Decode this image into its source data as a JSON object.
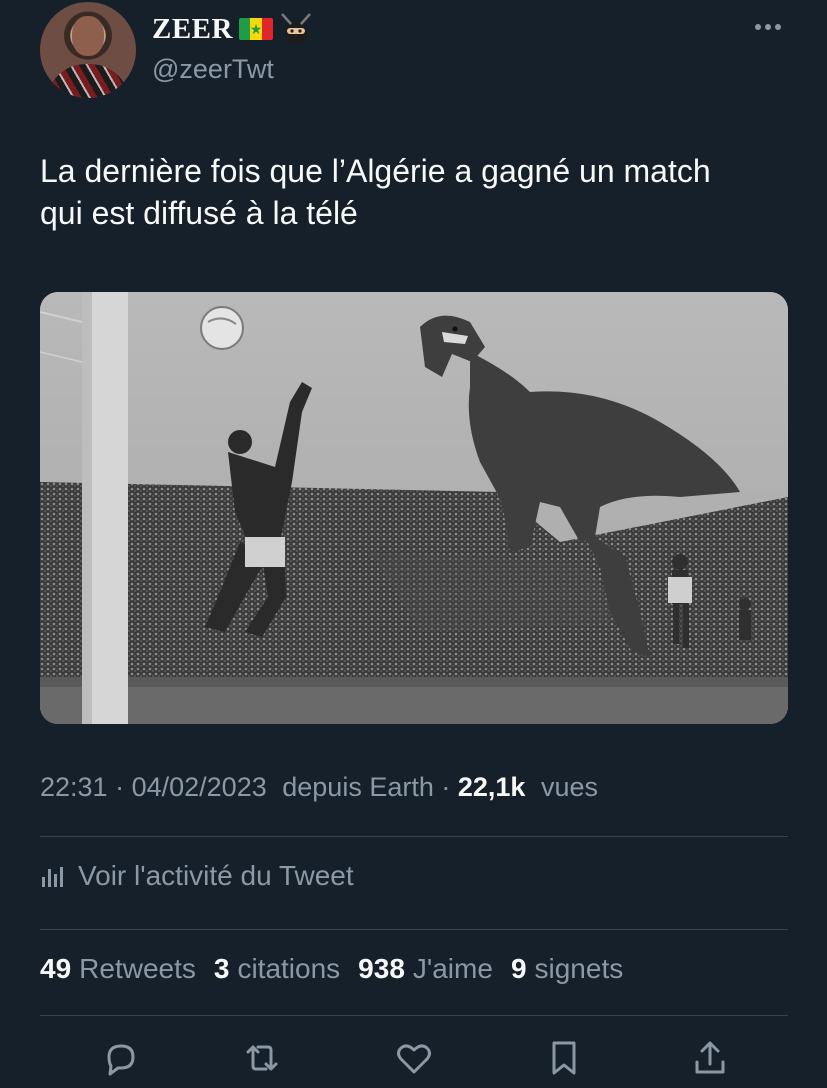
{
  "user": {
    "display_name": "ZEER",
    "handle": "@zeerTwt",
    "badges": [
      "senegal-flag-emoji",
      "ninja-emoji"
    ]
  },
  "tweet": {
    "text_line1": "La dernière fois que l’Algérie a gagné un match",
    "text_line2": "qui est diffusé à la télé",
    "time": "22:31",
    "date": "04/02/2023",
    "source": "depuis Earth",
    "views_count": "22,1k",
    "views_label": "vues"
  },
  "activity": {
    "label": "Voir l'activité du Tweet"
  },
  "stats": [
    {
      "count": "49",
      "label": "Retweets"
    },
    {
      "count": "3",
      "label": "citations"
    },
    {
      "count": "938",
      "label": "J'aime"
    },
    {
      "count": "9",
      "label": "signets"
    }
  ],
  "actions": [
    "reply-icon",
    "retweet-icon",
    "like-icon",
    "bookmark-icon",
    "share-icon"
  ],
  "colors": {
    "background": "#15202b",
    "text_primary": "#f7f9f9",
    "text_secondary": "#8b98a5",
    "divider": "#38444d"
  }
}
